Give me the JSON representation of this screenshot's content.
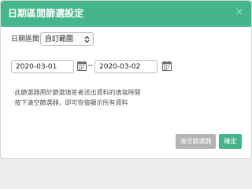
{
  "dialog": {
    "title": "日期區間篩選設定",
    "close_label": "×"
  },
  "range": {
    "label": "日期區間",
    "selected": "自訂範圍"
  },
  "dates": {
    "start": "2020-03-01",
    "separator": "~",
    "end": "2020-03-02"
  },
  "notes": [
    "‧此篩選器用於篩選填答者送出資料的填寫時間",
    "‧按下清空篩選器，即可恢復顯示所有資料"
  ],
  "buttons": {
    "clear_label": "清空篩選器",
    "ok_label": "確定"
  },
  "icons": {
    "close": "close-icon",
    "dropdown": "chevron-updown-icon",
    "calendar": "calendar-icon"
  },
  "colors": {
    "header": "#45b68a",
    "confirm_button": "#45b68a",
    "clear_button": "#b4b4b4"
  }
}
